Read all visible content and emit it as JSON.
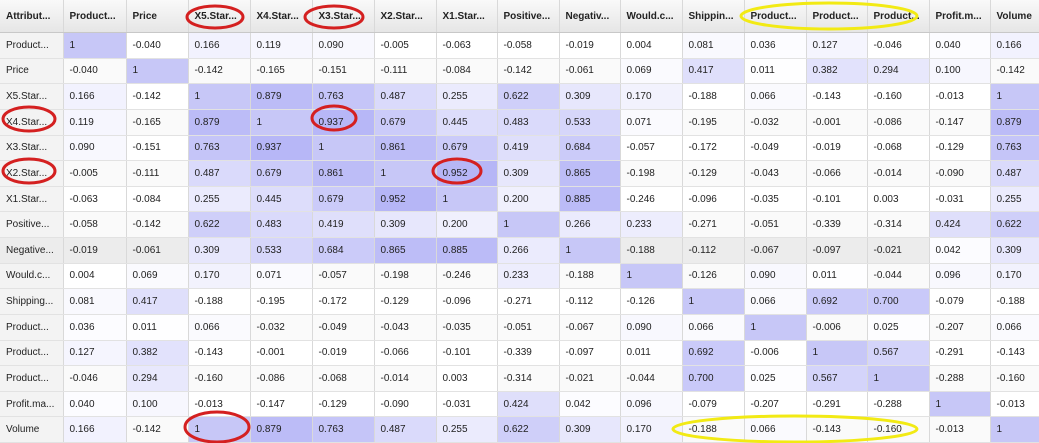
{
  "columns": [
    "Attribut...",
    "Product...",
    "Price",
    "X5.Star...",
    "X4.Star...",
    "X3.Star...",
    "X2.Star...",
    "X1.Star...",
    "Positive...",
    "Negativ...",
    "Would.c...",
    "Shippin...",
    "Product...",
    "Product...",
    "Product...",
    "Profit.m...",
    "Volume"
  ],
  "highlight_color": "#c7c7f7",
  "rows": [
    {
      "label": "Product...",
      "values": [
        "1",
        "-0.040",
        "0.166",
        "0.119",
        "0.090",
        "-0.005",
        "-0.063",
        "-0.058",
        "-0.019",
        "0.004",
        "0.081",
        "0.036",
        "0.127",
        "-0.046",
        "0.040",
        "0.166"
      ]
    },
    {
      "label": "Price",
      "values": [
        "-0.040",
        "1",
        "-0.142",
        "-0.165",
        "-0.151",
        "-0.111",
        "-0.084",
        "-0.142",
        "-0.061",
        "0.069",
        "0.417",
        "0.011",
        "0.382",
        "0.294",
        "0.100",
        "-0.142"
      ]
    },
    {
      "label": "X5.Star...",
      "values": [
        "0.166",
        "-0.142",
        "1",
        "0.879",
        "0.763",
        "0.487",
        "0.255",
        "0.622",
        "0.309",
        "0.170",
        "-0.188",
        "0.066",
        "-0.143",
        "-0.160",
        "-0.013",
        "1"
      ]
    },
    {
      "label": "X4.Star...",
      "values": [
        "0.119",
        "-0.165",
        "0.879",
        "1",
        "0.937",
        "0.679",
        "0.445",
        "0.483",
        "0.533",
        "0.071",
        "-0.195",
        "-0.032",
        "-0.001",
        "-0.086",
        "-0.147",
        "0.879"
      ]
    },
    {
      "label": "X3.Star...",
      "values": [
        "0.090",
        "-0.151",
        "0.763",
        "0.937",
        "1",
        "0.861",
        "0.679",
        "0.419",
        "0.684",
        "-0.057",
        "-0.172",
        "-0.049",
        "-0.019",
        "-0.068",
        "-0.129",
        "0.763"
      ]
    },
    {
      "label": "X2.Star...",
      "values": [
        "-0.005",
        "-0.111",
        "0.487",
        "0.679",
        "0.861",
        "1",
        "0.952",
        "0.309",
        "0.865",
        "-0.198",
        "-0.129",
        "-0.043",
        "-0.066",
        "-0.014",
        "-0.090",
        "0.487"
      ]
    },
    {
      "label": "X1.Star...",
      "values": [
        "-0.063",
        "-0.084",
        "0.255",
        "0.445",
        "0.679",
        "0.952",
        "1",
        "0.200",
        "0.885",
        "-0.246",
        "-0.096",
        "-0.035",
        "-0.101",
        "0.003",
        "-0.031",
        "0.255"
      ]
    },
    {
      "label": "Positive...",
      "values": [
        "-0.058",
        "-0.142",
        "0.622",
        "0.483",
        "0.419",
        "0.309",
        "0.200",
        "1",
        "0.266",
        "0.233",
        "-0.271",
        "-0.051",
        "-0.339",
        "-0.314",
        "0.424",
        "0.622"
      ]
    },
    {
      "label": "Negative...",
      "values": [
        "-0.019",
        "-0.061",
        "0.309",
        "0.533",
        "0.684",
        "0.865",
        "0.885",
        "0.266",
        "1",
        "-0.188",
        "-0.112",
        "-0.067",
        "-0.097",
        "-0.021",
        "0.042",
        "0.309"
      ]
    },
    {
      "label": "Would.c...",
      "values": [
        "0.004",
        "0.069",
        "0.170",
        "0.071",
        "-0.057",
        "-0.198",
        "-0.246",
        "0.233",
        "-0.188",
        "1",
        "-0.126",
        "0.090",
        "0.011",
        "-0.044",
        "0.096",
        "0.170"
      ]
    },
    {
      "label": "Shipping...",
      "values": [
        "0.081",
        "0.417",
        "-0.188",
        "-0.195",
        "-0.172",
        "-0.129",
        "-0.096",
        "-0.271",
        "-0.112",
        "-0.126",
        "1",
        "0.066",
        "0.692",
        "0.700",
        "-0.079",
        "-0.188"
      ]
    },
    {
      "label": "Product...",
      "values": [
        "0.036",
        "0.011",
        "0.066",
        "-0.032",
        "-0.049",
        "-0.043",
        "-0.035",
        "-0.051",
        "-0.067",
        "0.090",
        "0.066",
        "1",
        "-0.006",
        "0.025",
        "-0.207",
        "0.066"
      ]
    },
    {
      "label": "Product...",
      "values": [
        "0.127",
        "0.382",
        "-0.143",
        "-0.001",
        "-0.019",
        "-0.066",
        "-0.101",
        "-0.339",
        "-0.097",
        "0.011",
        "0.692",
        "-0.006",
        "1",
        "0.567",
        "-0.291",
        "-0.143"
      ]
    },
    {
      "label": "Product...",
      "values": [
        "-0.046",
        "0.294",
        "-0.160",
        "-0.086",
        "-0.068",
        "-0.014",
        "0.003",
        "-0.314",
        "-0.021",
        "-0.044",
        "0.700",
        "0.025",
        "0.567",
        "1",
        "-0.288",
        "-0.160"
      ]
    },
    {
      "label": "Profit.ma...",
      "values": [
        "0.040",
        "0.100",
        "-0.013",
        "-0.147",
        "-0.129",
        "-0.090",
        "-0.031",
        "0.424",
        "0.042",
        "0.096",
        "-0.079",
        "-0.207",
        "-0.291",
        "-0.288",
        "1",
        "-0.013"
      ]
    },
    {
      "label": "Volume",
      "values": [
        "0.166",
        "-0.142",
        "1",
        "0.879",
        "0.763",
        "0.487",
        "0.255",
        "0.622",
        "0.309",
        "0.170",
        "-0.188",
        "0.066",
        "-0.143",
        "-0.160",
        "-0.013",
        "1"
      ]
    }
  ],
  "annotations": {
    "red_color": "#d42020",
    "yellow_color": "#f2ea14"
  }
}
